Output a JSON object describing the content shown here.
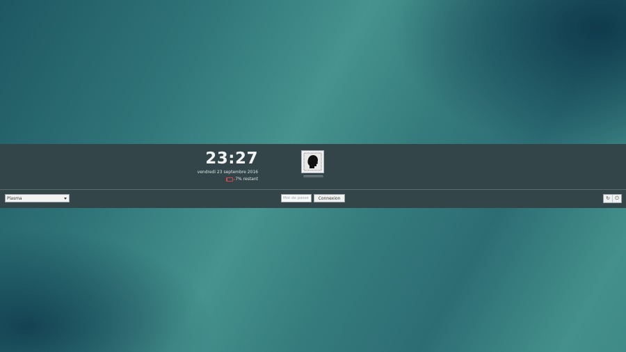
{
  "clock": {
    "time": "23:27",
    "date": "vendredi 23 septembre 2016"
  },
  "battery": {
    "label": "7% restant",
    "level_percent": 7,
    "color": "#d0484a"
  },
  "user": {
    "avatar_icon": "user-silhouette-icon"
  },
  "session": {
    "selected": "Plasma"
  },
  "login": {
    "password_placeholder": "Mot de passe",
    "button_label": "Connexion"
  },
  "power": {
    "restart_glyph": "↻",
    "shutdown_glyph": "⏻"
  },
  "colors": {
    "bar": "#34454a",
    "text": "#f2f4f4",
    "background_teal": "#46938f"
  }
}
